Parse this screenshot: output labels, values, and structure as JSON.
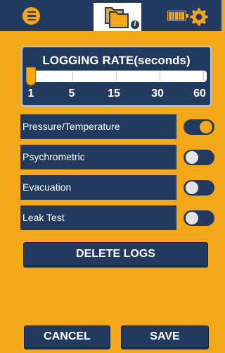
{
  "header": {
    "menu_icon": "hamburger-icon",
    "folder_icon": "folders-icon",
    "info_glyph": "i",
    "battery_icon": "battery-full-icon",
    "settings_icon": "gear-icon"
  },
  "logging_rate": {
    "title": "LOGGING RATE(seconds)",
    "ticks": [
      "1",
      "5",
      "15",
      "30",
      "60"
    ],
    "selected": "1"
  },
  "options": [
    {
      "label": "Pressure/Temperature",
      "enabled": true
    },
    {
      "label": "Psychrometric",
      "enabled": false
    },
    {
      "label": "Evacuation",
      "enabled": false
    },
    {
      "label": "Leak Test",
      "enabled": false
    }
  ],
  "actions": {
    "delete_logs": "DELETE LOGS",
    "cancel": "CANCEL",
    "save": "SAVE"
  },
  "colors": {
    "background": "#f2a818",
    "navy": "#213a5e",
    "accent": "#f4a71a",
    "toggle_off_knob": "#e3e3e3"
  }
}
